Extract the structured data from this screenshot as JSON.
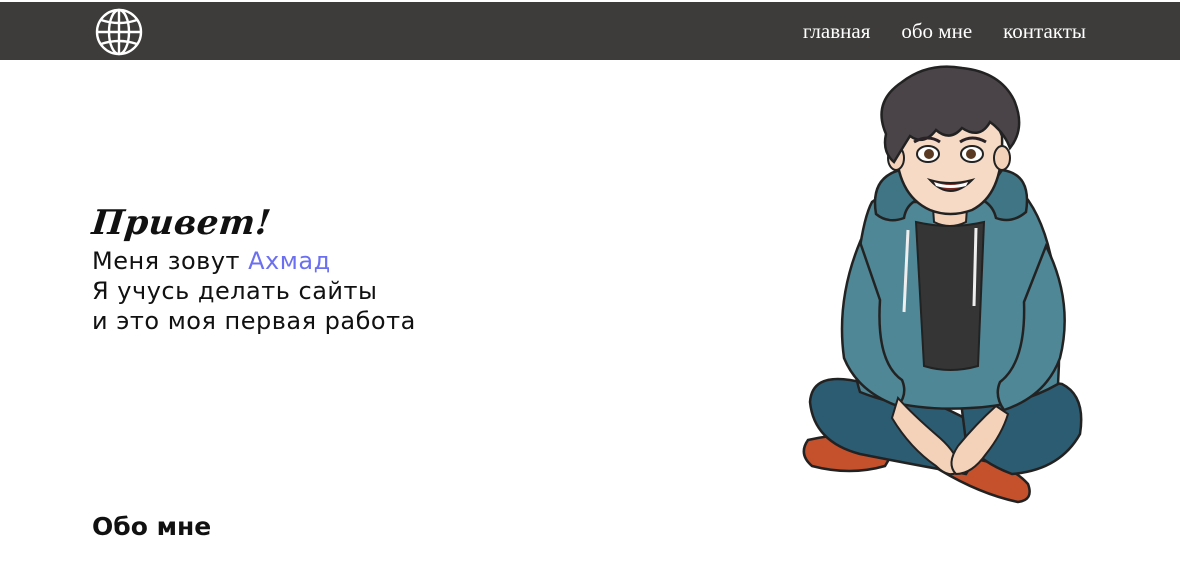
{
  "nav": {
    "logo_icon": "globe-icon",
    "items": [
      {
        "label": "главная"
      },
      {
        "label": "обо мне"
      },
      {
        "label": "контакты"
      }
    ]
  },
  "hero": {
    "greeting": "Привет!",
    "intro_prefix": "Меня зовут ",
    "name": "Ахмад",
    "line2": "Я учусь делать сайты",
    "line3": "и это моя первая работа",
    "image": "boy-in-hoodie-illustration"
  },
  "about": {
    "title": "Обо мне"
  },
  "colors": {
    "header_bg": "#3d3c3a",
    "accent": "#6b6ff0",
    "text": "#111111"
  }
}
